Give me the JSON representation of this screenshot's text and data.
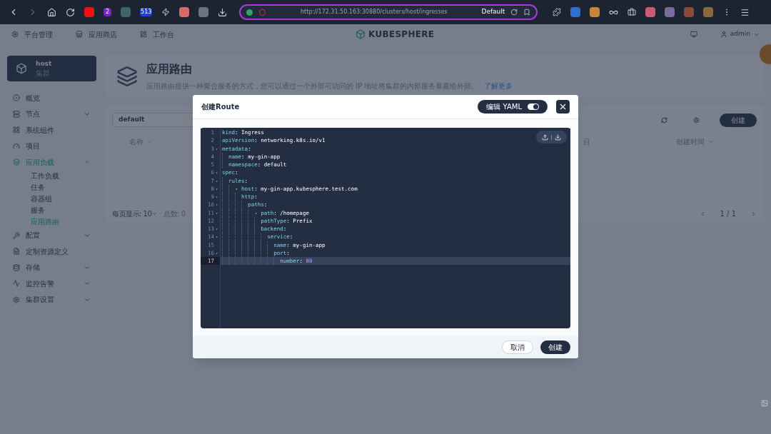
{
  "browser": {
    "url": "http://172.31.50.163:30880/clusters/host/ingresses",
    "profile": "Default",
    "badges": [
      "2",
      "513"
    ]
  },
  "topnav": {
    "items": [
      "平台管理",
      "应用商店",
      "工作台"
    ],
    "logo": "KUBESPHERE",
    "user": "admin"
  },
  "sidebar": {
    "cluster": {
      "name": "host",
      "type": "集群"
    },
    "items": [
      {
        "label": "概览",
        "kind": "link",
        "selected": false
      },
      {
        "label": "节点",
        "kind": "group",
        "expanded": false,
        "selected": false
      },
      {
        "label": "系统组件",
        "kind": "link",
        "selected": false
      },
      {
        "label": "项目",
        "kind": "link",
        "selected": false
      },
      {
        "label": "应用负载",
        "kind": "group",
        "expanded": true,
        "selected": true,
        "children": [
          {
            "label": "工作负载",
            "selected": false
          },
          {
            "label": "任务",
            "selected": false
          },
          {
            "label": "容器组",
            "selected": false
          },
          {
            "label": "服务",
            "selected": false
          },
          {
            "label": "应用路由",
            "selected": true
          }
        ]
      },
      {
        "label": "配置",
        "kind": "group",
        "expanded": false,
        "selected": false
      },
      {
        "label": "定制资源定义",
        "kind": "link",
        "selected": false
      },
      {
        "label": "存储",
        "kind": "group",
        "expanded": false,
        "selected": false
      },
      {
        "label": "监控告警",
        "kind": "group",
        "expanded": false,
        "selected": false
      },
      {
        "label": "集群设置",
        "kind": "group",
        "expanded": false,
        "selected": false
      }
    ]
  },
  "page": {
    "title": "应用路由",
    "description": "应用路由提供一种聚合服务的方式，您可以通过一个外部可访问的 IP 地址将集群的内部服务暴露给外部。",
    "learn_more": "了解更多",
    "project_filter": "default",
    "create_button": "创建",
    "table": {
      "columns": [
        "名称",
        "目",
        "创建时间"
      ]
    },
    "footer": {
      "page_size_label": "每页显示: 10",
      "total": "总数: 0",
      "pages": "1 / 1"
    }
  },
  "dialog": {
    "title": "创建Route",
    "yaml_toggle": {
      "label": "编辑 YAML",
      "on": true
    },
    "lines": [
      {
        "num": "1",
        "selected": false,
        "key": "kind",
        "sep": ": ",
        "value": "Ingress",
        "kind": "string"
      },
      {
        "num": "2",
        "selected": false,
        "key": "apiVersion",
        "sep": ": ",
        "value": "networking.k8s.io/v1",
        "kind": "string"
      },
      {
        "num": "3",
        "fold": "▾",
        "selected": false,
        "key": "metadata",
        "sep": ":"
      },
      {
        "num": "4",
        "selected": false,
        "key": "  name",
        "sep": ": ",
        "value": "my-gin-app",
        "kind": "string"
      },
      {
        "num": "5",
        "selected": false,
        "key": "  namespace",
        "sep": ": ",
        "value": "default",
        "kind": "string"
      },
      {
        "num": "6",
        "fold": "▾",
        "selected": false,
        "key": "spec",
        "sep": ":"
      },
      {
        "num": "7",
        "fold": "▾",
        "selected": false,
        "key": "  rules",
        "sep": ":"
      },
      {
        "num": "8",
        "fold": "▾",
        "selected": false,
        "lead": "    - ",
        "key": "host",
        "sep": ": ",
        "value": "my-gin-app.kubesphere.test.com",
        "kind": "string"
      },
      {
        "num": "9",
        "fold": "▾",
        "selected": false,
        "key": "      http",
        "sep": ":"
      },
      {
        "num": "10",
        "fold": "▾",
        "selected": false,
        "key": "        paths",
        "sep": ":"
      },
      {
        "num": "11",
        "fold": "▾",
        "selected": false,
        "lead": "          - ",
        "key": "path",
        "sep": ": ",
        "value": "/homepage",
        "kind": "string"
      },
      {
        "num": "12",
        "selected": false,
        "key": "            pathType",
        "sep": ": ",
        "value": "Prefix",
        "kind": "string"
      },
      {
        "num": "13",
        "fold": "▾",
        "selected": false,
        "key": "            backend",
        "sep": ":"
      },
      {
        "num": "14",
        "fold": "▾",
        "selected": false,
        "key": "              service",
        "sep": ":"
      },
      {
        "num": "15",
        "selected": false,
        "key": "                name",
        "sep": ": ",
        "value": "my-gin-app",
        "kind": "string"
      },
      {
        "num": "16",
        "fold": "▾",
        "selected": false,
        "key": "                port",
        "sep": ":"
      },
      {
        "num": "17",
        "selected": true,
        "key": "                  number",
        "sep": ": ",
        "value": "80",
        "kind": "number"
      }
    ],
    "buttons": [
      "取消",
      "创建"
    ]
  }
}
